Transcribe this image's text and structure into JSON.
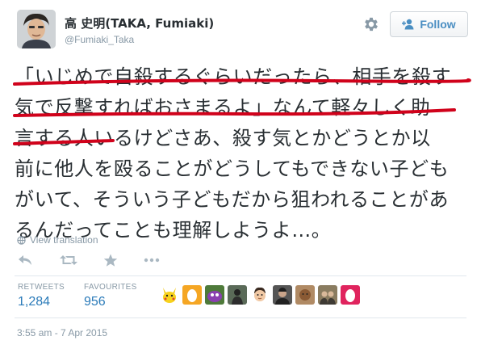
{
  "user": {
    "display_name": "高 史明(TAKA, Fumiaki)",
    "handle": "@Fumiaki_Taka",
    "follow_label": "Follow"
  },
  "tweet": {
    "lines": [
      "「いじめで自殺するぐらいだったら、相手を殺す",
      "気で反撃すればおさまるよ」なんて軽々しく助",
      "言する人いるけどさあ、殺す気とかどうとか以",
      "前に他人を殴ることがどうしてもできない子ども",
      "がいて、そういう子どもだから狙われることがあ",
      "るんだってことも理解しようよ…。"
    ],
    "underline_color": "#d0021b"
  },
  "view_translation": "View translation",
  "stats": {
    "retweets_label": "RETWEETS",
    "retweets_value": "1,284",
    "favourites_label": "FAVOURITES",
    "favourites_value": "956"
  },
  "favouriters": [
    {
      "icon": "pikachu-avatar"
    },
    {
      "icon": "egg-avatar"
    },
    {
      "icon": "purple-creature-avatar"
    },
    {
      "icon": "dark-figure-avatar"
    },
    {
      "icon": "cartoon-face-avatar"
    },
    {
      "icon": "person-photo-avatar"
    },
    {
      "icon": "doll-avatar"
    },
    {
      "icon": "group-photo-avatar"
    },
    {
      "icon": "egg-avatar"
    }
  ],
  "timestamp": "3:55 am - 7 Apr 2015",
  "colors": {
    "link_blue": "#2b7bb9",
    "meta_gray": "#8899a6",
    "text": "#292f33",
    "egg_orange": "#f5a623"
  }
}
